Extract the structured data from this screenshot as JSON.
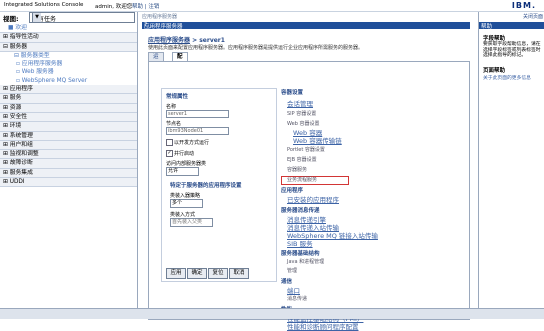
{
  "topbar": {
    "product": "Integrated Solutions Console",
    "welcome": "admin, 欢迎您",
    "help": "帮助",
    "logout": "注销",
    "ibm": "IBM."
  },
  "left": {
    "view_label": "视图:",
    "view_value": "所有任务",
    "items": [
      {
        "label": "■ 欢迎",
        "type": "plain"
      },
      {
        "label": "⊞ 指导性活动",
        "type": "top"
      },
      {
        "label": "⊟ 服务器",
        "type": "top"
      },
      {
        "label": "⊟ 服务器类型",
        "type": "sub"
      },
      {
        "label": "▫ 应用程序服务器",
        "type": "sub2"
      },
      {
        "label": "▫ Web 服务器",
        "type": "sub2"
      },
      {
        "label": "▫ WebSphere MQ Server",
        "type": "sub2"
      },
      {
        "label": "⊞ 应用程序",
        "type": "top"
      },
      {
        "label": "⊞ 服务",
        "type": "top"
      },
      {
        "label": "⊞ 资源",
        "type": "top"
      },
      {
        "label": "⊞ 安全性",
        "type": "top"
      },
      {
        "label": "⊞ 环境",
        "type": "top"
      },
      {
        "label": "⊞ 系统管理",
        "type": "top"
      },
      {
        "label": "⊞ 用户和组",
        "type": "top"
      },
      {
        "label": "⊞ 监视和调整",
        "type": "top"
      },
      {
        "label": "⊞ 故障诊断",
        "type": "top"
      },
      {
        "label": "⊞ 服务集成",
        "type": "top"
      },
      {
        "label": "⊞ UDDI",
        "type": "top"
      }
    ]
  },
  "main": {
    "crumb": "应用程序服务器",
    "panel_title": "应用程序服务器",
    "path_link": "应用程序服务器",
    "path_current": "> server1",
    "description": "使用此页面来配置应用程序服务器。应用程序服务器是提供运行企业应用程序所需服务的服务器。",
    "tabs": {
      "runtime": "运行时",
      "config": "配置"
    },
    "general": {
      "section": "常规属性",
      "name_label": "名称",
      "name_value": "server1",
      "node_label": "节点名",
      "node_value": "ibm93Node01",
      "dev_mode": "以开发方式运行",
      "parallel_start": "并行启动",
      "access_label": "访问内部服务器类",
      "access_value": "允许",
      "classloader_section": "特定于服务器的应用程序设置",
      "policy_label": "类装入器策略",
      "policy_value": "多个",
      "mode_label": "类装入方式",
      "mode_value": "首先装入父类"
    },
    "buttons": {
      "apply": "应用",
      "ok": "确定",
      "reset": "复位",
      "cancel": "取消"
    },
    "links": {
      "container_settings": "容器设置",
      "session_mgmt": "会话管理",
      "sip_settings": "SIP 容器设置",
      "web_settings": "Web 容器设置",
      "web_container": "Web 容器",
      "web_transport": "Web 容器传输链",
      "portlet": "Portlet 容器设置",
      "ejb": "EJB 容器设置",
      "container_services": "容器服务",
      "business_process": "业务流程服务",
      "applications_hd": "应用程序",
      "installed_apps": "已安装的应用程序",
      "messaging_hd": "服务器消息传递",
      "msg_engine": "消息传递引擎",
      "msg_inbound": "消息传递入站传输",
      "mq_transport": "WebSphere MQ 链接入站传输",
      "sib": "SIB 服务",
      "infra_hd": "服务器基础结构",
      "java_process": "Java 和进程管理",
      "admin": "管理",
      "comm_hd": "通信",
      "ports": "端口",
      "msg_queue": "消息传递",
      "perf_hd": "性能",
      "pmi": "性能监控基础结构（PMI）",
      "tuning": "性能和诊断顾问程序配置"
    }
  },
  "help": {
    "title": "帮助",
    "close": "关闭页面",
    "field_help": "字段帮助",
    "field_desc": "要获取字段帮助信息，请在 选择字段标签或列表标签时 选择此指导的标记。",
    "page_help": "页面帮助",
    "page_link": "关于此页面的更多信息"
  }
}
